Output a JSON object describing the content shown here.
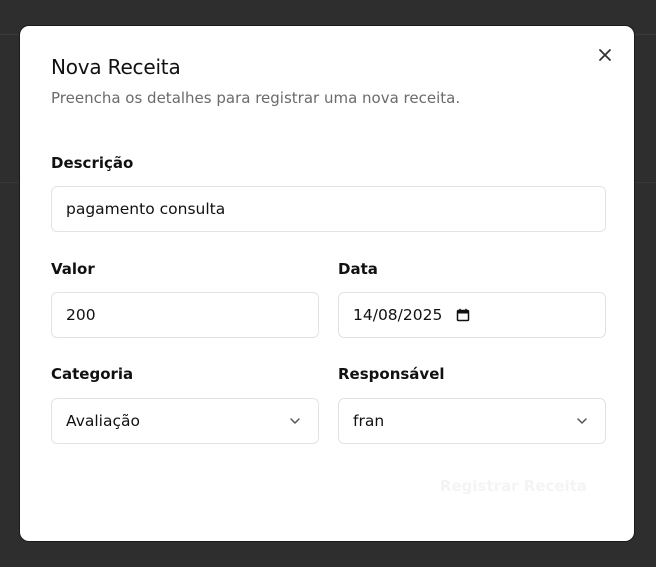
{
  "modal": {
    "title": "Nova Receita",
    "subtitle": "Preencha os detalhes para registrar uma nova receita.",
    "close_icon": "close-icon"
  },
  "form": {
    "descricao": {
      "label": "Descrição",
      "value": "pagamento consulta"
    },
    "valor": {
      "label": "Valor",
      "value": "200"
    },
    "data": {
      "label": "Data",
      "value": "14/08/2025",
      "icon": "calendar-icon"
    },
    "categoria": {
      "label": "Categoria",
      "selected": "Avaliação",
      "icon": "chevron-down-icon"
    },
    "responsavel": {
      "label": "Responsável",
      "selected": "fran",
      "icon": "chevron-down-icon"
    }
  },
  "actions": {
    "submit_label": "Registrar Receita"
  },
  "colors": {
    "backdrop": "#2e2e2e",
    "modal_bg": "#ffffff",
    "text": "#111111",
    "muted": "#6b6b6b",
    "border": "#e3e3e3"
  }
}
